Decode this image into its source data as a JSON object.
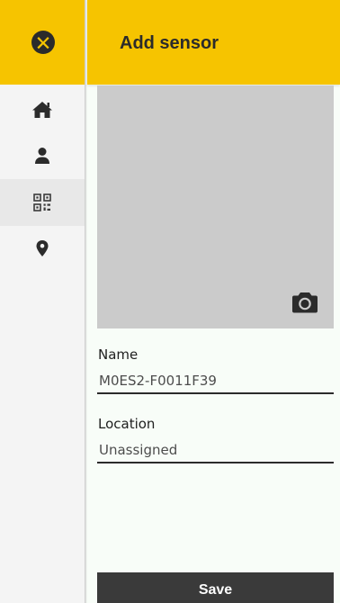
{
  "header": {
    "title": "Add sensor"
  },
  "sidebar": {
    "logo_icon": "x-logo-icon",
    "items": [
      {
        "icon": "home-icon",
        "active": false
      },
      {
        "icon": "person-icon",
        "active": false
      },
      {
        "icon": "qr-code-icon",
        "active": true
      },
      {
        "icon": "location-pin-icon",
        "active": false
      }
    ]
  },
  "photo": {
    "camera_icon": "camera-icon"
  },
  "form": {
    "name": {
      "label": "Name",
      "value": "M0ES2-F0011F39"
    },
    "location": {
      "label": "Location",
      "value": "Unassigned"
    }
  },
  "actions": {
    "save_label": "Save"
  },
  "colors": {
    "accent": "#f6c400",
    "dark": "#2b2b2b",
    "sidebar_bg": "#f4f4f4",
    "sidebar_active": "#e8e8e8",
    "photo_placeholder": "#cbcbcb",
    "button_bg": "#3a3a3a"
  }
}
